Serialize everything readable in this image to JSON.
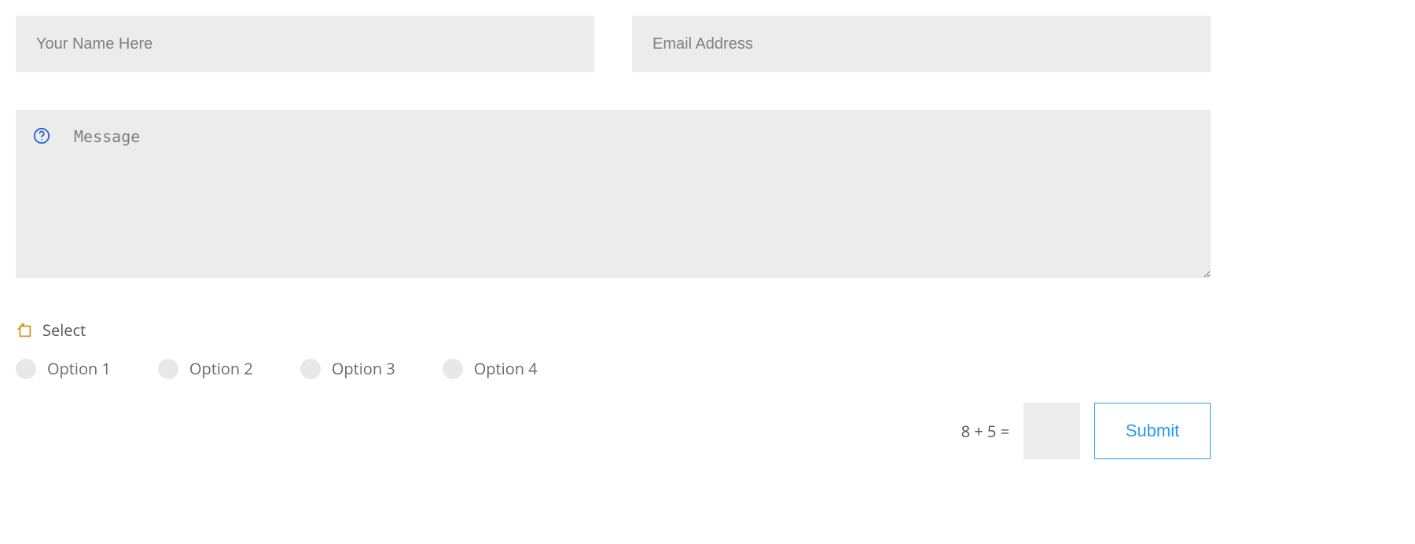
{
  "name_field": {
    "placeholder": "Your Name Here",
    "value": ""
  },
  "email_field": {
    "placeholder": "Email Address",
    "value": ""
  },
  "message_field": {
    "placeholder": "Message",
    "value": ""
  },
  "select": {
    "label": "Select",
    "options": [
      "Option 1",
      "Option 2",
      "Option 3",
      "Option 4"
    ]
  },
  "captcha": {
    "question": "8 + 5 =",
    "value": ""
  },
  "submit_label": "Submit",
  "colors": {
    "accent": "#2a9df4",
    "field_bg": "#ececec",
    "help_icon": "#2a62d6",
    "select_icon": "#d69a2a"
  }
}
